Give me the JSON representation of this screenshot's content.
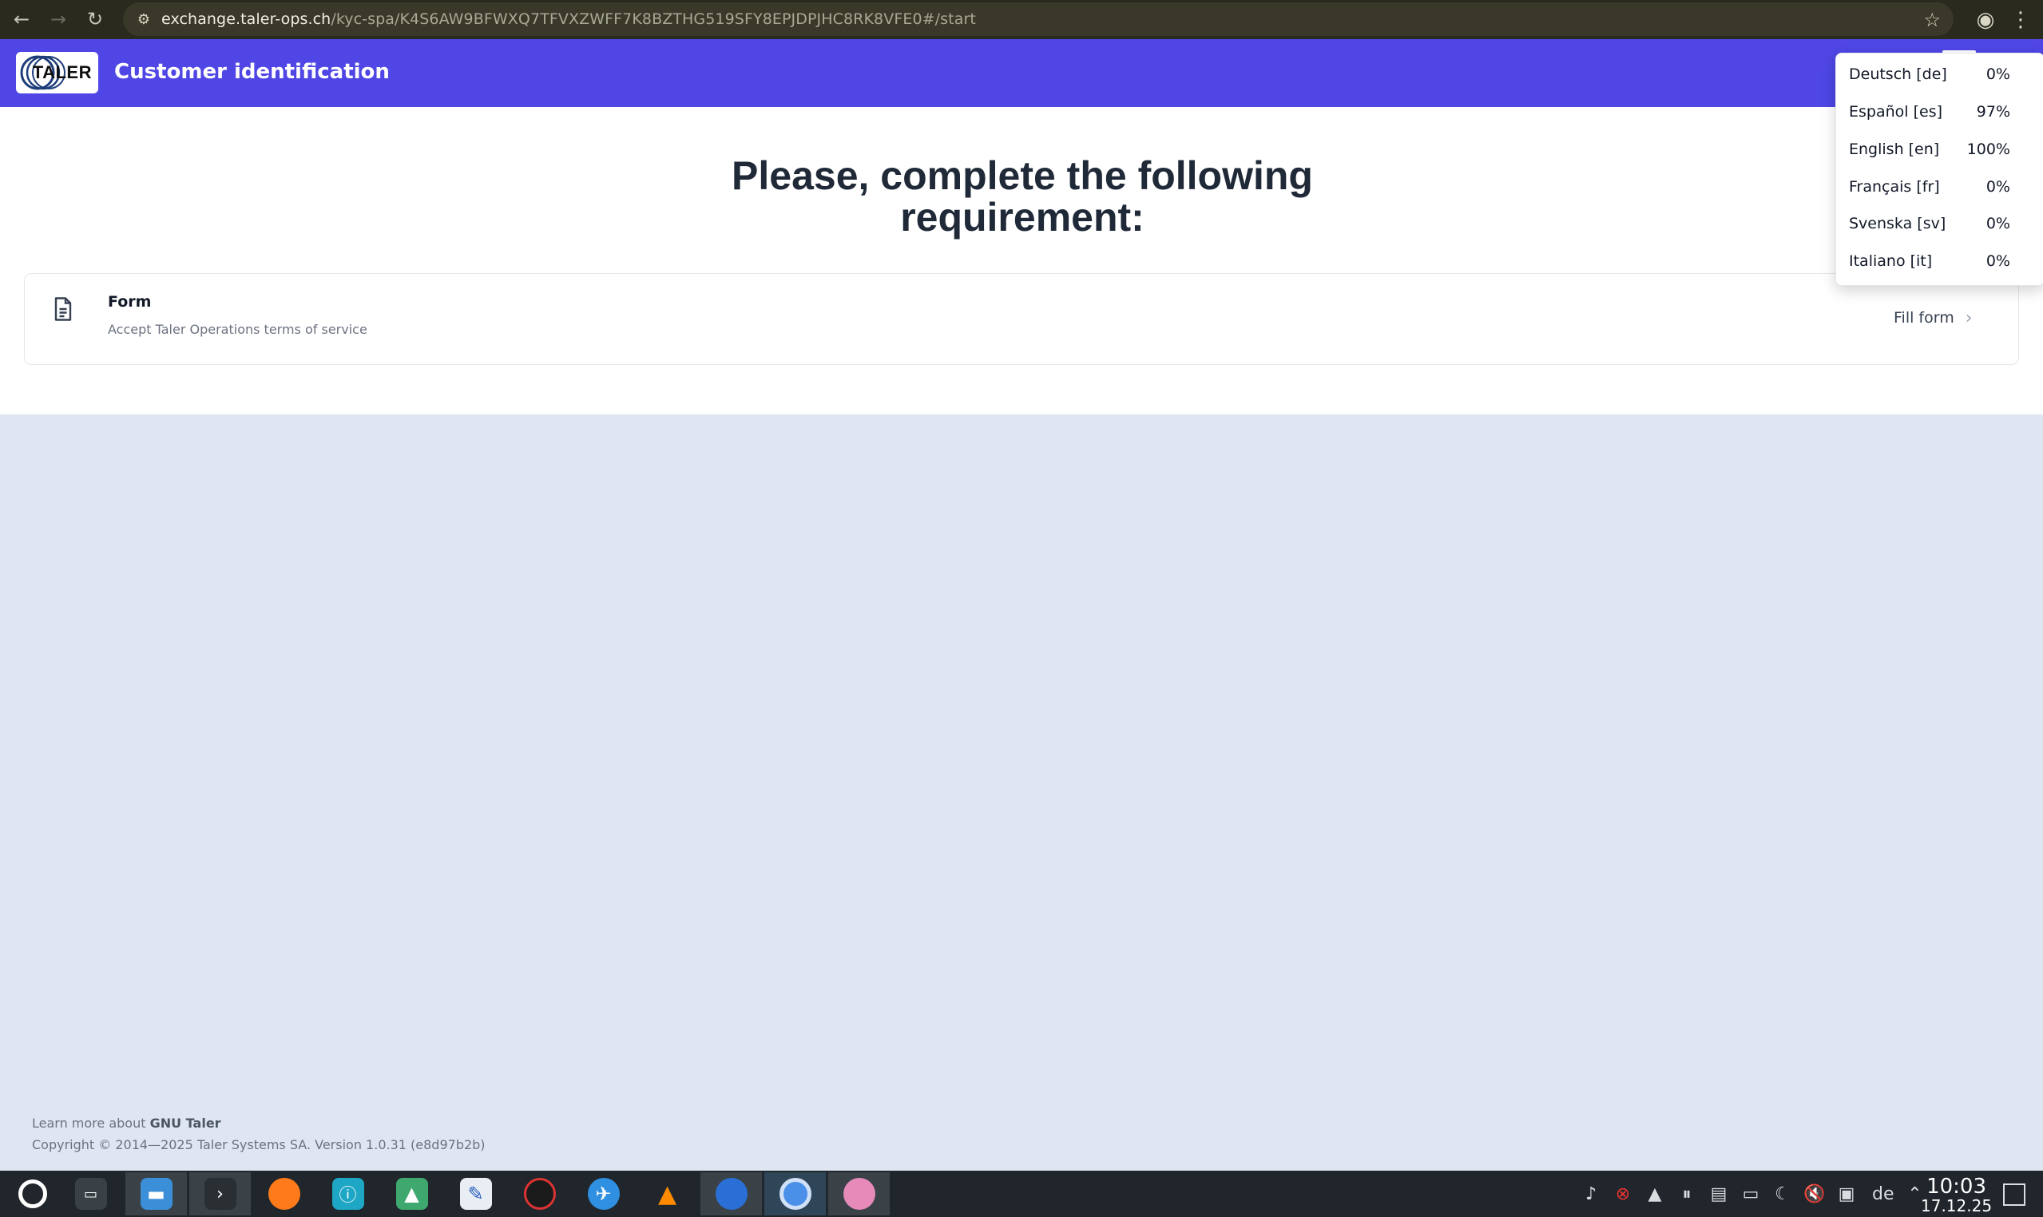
{
  "browser": {
    "url_host": "exchange.taler-ops.ch",
    "url_path": "/kyc-spa/K4S6AW9BFWXQ7TFVXZWFF7K8BZTHG519SFY8EPJDPJHC8RK8VFE0#/start",
    "back_icon": "←",
    "forward_icon": "→",
    "reload_icon": "↻",
    "site_info_icon": "⚙",
    "star_icon": "☆",
    "profile_icon": "◉",
    "menu_icon": "⋮"
  },
  "header": {
    "logo_text": "TALER",
    "title": "Customer identification"
  },
  "main": {
    "heading": "Please, complete the following requirement:",
    "requirement": {
      "title": "Form",
      "description": "Accept Taler Operations terms of service",
      "action_label": "Fill form",
      "action_chevron": "›"
    }
  },
  "language_menu": {
    "items": [
      {
        "label": "Deutsch [de]",
        "percent": "0%"
      },
      {
        "label": "Español [es]",
        "percent": "97%"
      },
      {
        "label": "English [en]",
        "percent": "100%"
      },
      {
        "label": "Français [fr]",
        "percent": "0%"
      },
      {
        "label": "Svenska [sv]",
        "percent": "0%"
      },
      {
        "label": "Italiano [it]",
        "percent": "0%"
      }
    ]
  },
  "footer": {
    "learn_more_prefix": "Learn more about",
    "learn_more_link": "GNU Taler",
    "copyright": "Copyright © 2014—2025 Taler Systems SA. Version 1.0.31 (e8d97b2b)"
  },
  "taskbar": {
    "tray_language": "de",
    "time": "10:03",
    "date": "17.12.25",
    "colors": {
      "background": "#20262b",
      "accent": "#4f46e5"
    }
  }
}
